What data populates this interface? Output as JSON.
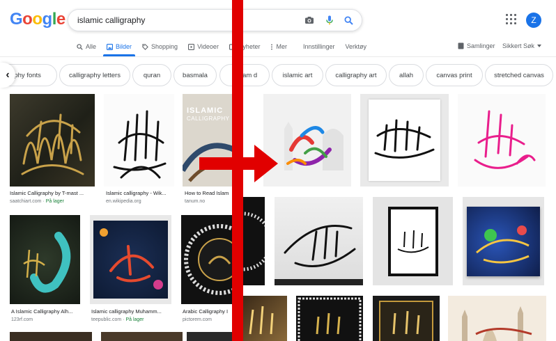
{
  "logo": {
    "text": "Google"
  },
  "search": {
    "query": "islamic calligraphy"
  },
  "avatar_letter": "Z",
  "tabs": [
    {
      "label": "Alle"
    },
    {
      "label": "Bilder"
    },
    {
      "label": "Shopping"
    },
    {
      "label": "Videoer"
    },
    {
      "label": "Nyheter"
    },
    {
      "label": "Mer"
    },
    {
      "label": "Innstillinger"
    },
    {
      "label": "Verktøy"
    }
  ],
  "tools": {
    "collections": "Samlinger",
    "safesearch": "Sikkert Søk"
  },
  "chips": [
    {
      "label": "aphy fonts"
    },
    {
      "label": "calligraphy letters"
    },
    {
      "label": "quran"
    },
    {
      "label": "basmala"
    },
    {
      "label": "m  yam d"
    },
    {
      "label": "islamic art"
    },
    {
      "label": "calligraphy art"
    },
    {
      "label": "allah"
    },
    {
      "label": "canvas print"
    },
    {
      "label": "stretched canvas"
    }
  ],
  "results": [
    {
      "title": "Islamic Calligraphy by T-mast ...",
      "source": "saatchiart.com",
      "badge": "På lager"
    },
    {
      "title": "Islamic calligraphy - Wik...",
      "source": "en.wikipedia.org",
      "badge": ""
    },
    {
      "title": "How to Read Islam",
      "source": "tanum.no",
      "badge": "",
      "book_title": "ISLAMIC",
      "book_sub": "CALLIGRAPHY"
    },
    {
      "title": "A Islamic Calligraphy Alh...",
      "source": "123rf.com",
      "badge": ""
    },
    {
      "title": "Islamic calligraphy Muhamm...",
      "source": "teepublic.com",
      "badge": "På lager"
    },
    {
      "title": "Arabic Calligraphy I",
      "source": "pictorem.com",
      "badge": ""
    }
  ],
  "colors": {
    "accent": "#1a73e8",
    "overlay": "#e10000",
    "in_stock": "#188038"
  }
}
